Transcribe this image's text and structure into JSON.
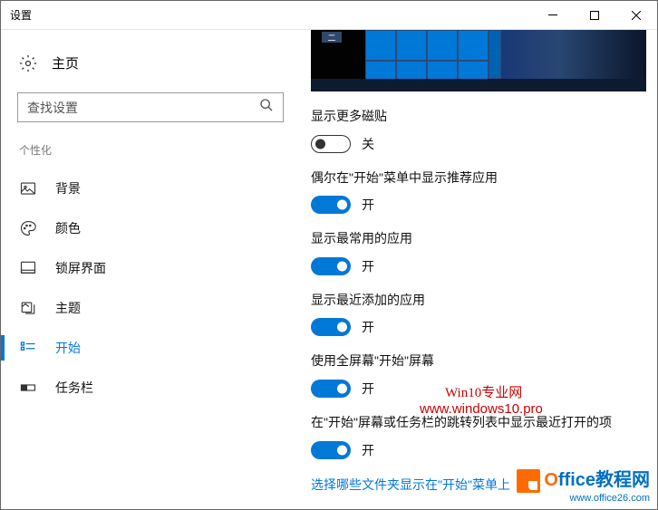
{
  "titlebar": {
    "title": "设置"
  },
  "sidebar": {
    "home": "主页",
    "search_placeholder": "查找设置",
    "section": "个性化",
    "items": [
      {
        "label": "背景"
      },
      {
        "label": "颜色"
      },
      {
        "label": "锁屏界面"
      },
      {
        "label": "主题"
      },
      {
        "label": "开始"
      },
      {
        "label": "任务栏"
      }
    ]
  },
  "content": {
    "preview_text": "二",
    "settings": [
      {
        "label": "显示更多磁贴",
        "state": "off",
        "text": "关"
      },
      {
        "label": "偶尔在\"开始\"菜单中显示推荐应用",
        "state": "on",
        "text": "开"
      },
      {
        "label": "显示最常用的应用",
        "state": "on",
        "text": "开"
      },
      {
        "label": "显示最近添加的应用",
        "state": "on",
        "text": "开"
      },
      {
        "label": "使用全屏幕\"开始\"屏幕",
        "state": "on",
        "text": "开"
      },
      {
        "label": "在\"开始\"屏幕或任务栏的跳转列表中显示最近打开的项",
        "state": "on",
        "text": "开"
      }
    ],
    "link": "选择哪些文件夹显示在\"开始\"菜单上"
  },
  "watermarks": {
    "w1": "Win10专业网",
    "w2": "www.windows10.pro",
    "brand_o": "O",
    "brand_rest": "ffice教程网",
    "brand_url": "www.office26.com"
  }
}
